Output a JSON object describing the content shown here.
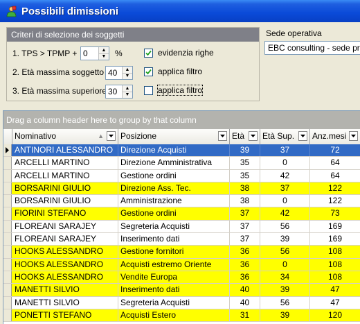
{
  "window": {
    "title": "Possibili dimissioni"
  },
  "criteria": {
    "header": "Criteri di selezione dei soggetti",
    "tps_label": "1. TPS > TPMP +",
    "tps_value": "0",
    "tps_unit": "%",
    "eta_label": "2. Età massima soggetto",
    "eta_value": "40",
    "eta_sup_label": "3. Età massima superiore:",
    "eta_sup_value": "30",
    "evidenzia_label": "evidenzia righe",
    "evidenzia_checked": true,
    "applica_label": "applica filtro",
    "applica_checked": true,
    "applica2_label": "applica filtro",
    "applica2_checked": false
  },
  "sede": {
    "label": "Sede operativa",
    "value": "EBC consulting - sede principale"
  },
  "grid": {
    "group_panel": "Drag a column header here to group by that column",
    "columns": [
      "Nominativo",
      "Posizione",
      "Età",
      "Età Sup.",
      "Anz.mesi"
    ],
    "rows": [
      {
        "nome": "ANTINORI ALESSANDRO",
        "pos": "Direzione Acquisti",
        "eta": "39",
        "eta_sup": "37",
        "anz": "72",
        "state": "selected"
      },
      {
        "nome": "ARCELLI MARTINO",
        "pos": "Direzione Amministrativa",
        "eta": "35",
        "eta_sup": "0",
        "anz": "64",
        "state": "normal"
      },
      {
        "nome": "ARCELLI MARTINO",
        "pos": "Gestione ordini",
        "eta": "35",
        "eta_sup": "42",
        "anz": "64",
        "state": "normal"
      },
      {
        "nome": "BORSARINI GIULIO",
        "pos": "Direzione Ass. Tec.",
        "eta": "38",
        "eta_sup": "37",
        "anz": "122",
        "state": "highlight"
      },
      {
        "nome": "BORSARINI GIULIO",
        "pos": "Amministrazione",
        "eta": "38",
        "eta_sup": "0",
        "anz": "122",
        "state": "normal"
      },
      {
        "nome": "FIORINI STEFANO",
        "pos": "Gestione ordini",
        "eta": "37",
        "eta_sup": "42",
        "anz": "73",
        "state": "highlight"
      },
      {
        "nome": "FLOREANI SARAJEY",
        "pos": "Segreteria Acquisti",
        "eta": "37",
        "eta_sup": "56",
        "anz": "169",
        "state": "normal"
      },
      {
        "nome": "FLOREANI SARAJEY",
        "pos": "Inserimento dati",
        "eta": "37",
        "eta_sup": "39",
        "anz": "169",
        "state": "normal"
      },
      {
        "nome": "HOOKS ALESSANDRO",
        "pos": "Gestione fornitori",
        "eta": "36",
        "eta_sup": "56",
        "anz": "108",
        "state": "highlight"
      },
      {
        "nome": "HOOKS ALESSANDRO",
        "pos": "Acquisti estremo Oriente",
        "eta": "36",
        "eta_sup": "0",
        "anz": "108",
        "state": "highlight"
      },
      {
        "nome": "HOOKS ALESSANDRO",
        "pos": "Vendite Europa",
        "eta": "36",
        "eta_sup": "34",
        "anz": "108",
        "state": "highlight"
      },
      {
        "nome": "MANETTI SILVIO",
        "pos": "Inserimento dati",
        "eta": "40",
        "eta_sup": "39",
        "anz": "47",
        "state": "highlight"
      },
      {
        "nome": "MANETTI SILVIO",
        "pos": "Segreteria Acquisti",
        "eta": "40",
        "eta_sup": "56",
        "anz": "47",
        "state": "normal"
      },
      {
        "nome": "PONETTI STEFANO",
        "pos": "Acquisti Estero",
        "eta": "31",
        "eta_sup": "39",
        "anz": "120",
        "state": "highlight"
      }
    ]
  },
  "colors": {
    "highlight": "#ffff00",
    "selected": "#316ac5",
    "titlebar": "#0a4ad8"
  }
}
